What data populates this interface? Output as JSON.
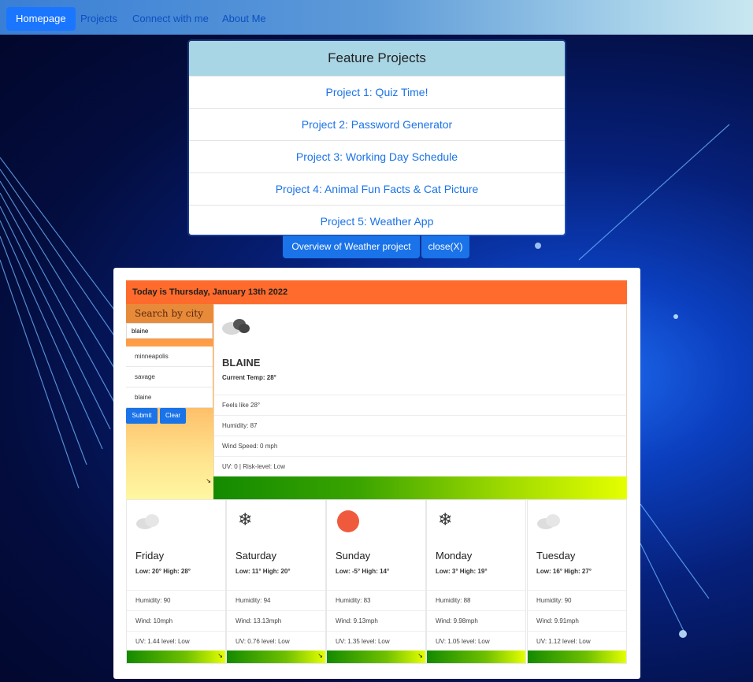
{
  "nav": {
    "items": [
      "Homepage",
      "Projects",
      "Connect with me",
      "About Me"
    ]
  },
  "projects_panel": {
    "title": "Feature Projects",
    "items": [
      "Project 1: Quiz Time!",
      "Project 2: Password Generator",
      "Project 3: Working Day Schedule",
      "Project 4: Animal Fun Facts & Cat Picture",
      "Project 5: Weather App"
    ]
  },
  "overview_button": "Overview of Weather project",
  "close_button": "close(X)",
  "weather": {
    "date": "Today is Thursday, January 13th 2022",
    "search_title": "Search by city",
    "search_value": "blaine",
    "history": [
      "minneapolis",
      "savage",
      "blaine"
    ],
    "submit": "Submit",
    "clear": "Clear",
    "current": {
      "icon": "cloud-icon",
      "city": "BLAINE",
      "temp": "Current Temp: 28°",
      "feels": "Feels like 28°",
      "humidity": "Humidity: 87",
      "wind": "Wind Speed: 0 mph",
      "uv": "UV: 0 | Risk-level: Low"
    },
    "forecast": [
      {
        "day": "Friday",
        "range": "Low: 20° High: 28°",
        "humidity": "Humidity: 90",
        "wind": "Wind: 10mph",
        "uv": "UV: 1.44 level: Low",
        "icon": "cloud-icon"
      },
      {
        "day": "Saturday",
        "range": "Low: 11° High: 20°",
        "humidity": "Humidity: 94",
        "wind": "Wind: 13.13mph",
        "uv": "UV: 0.76 level: Low",
        "icon": "snowflake-icon"
      },
      {
        "day": "Sunday",
        "range": "Low: -5° High: 14°",
        "humidity": "Humidity: 83",
        "wind": "Wind: 9.13mph",
        "uv": "UV: 1.35 level: Low",
        "icon": "sun-icon"
      },
      {
        "day": "Monday",
        "range": "Low: 3° High: 19°",
        "humidity": "Humidity: 88",
        "wind": "Wind: 9.98mph",
        "uv": "UV: 1.05 level: Low",
        "icon": "snowflake-icon"
      },
      {
        "day": "Tuesday",
        "range": "Low: 16° High: 27°",
        "humidity": "Humidity: 90",
        "wind": "Wind: 9.91mph",
        "uv": "UV: 1.12 level: Low",
        "icon": "cloud-icon"
      }
    ]
  },
  "colors": {
    "accent": "#1a73e8",
    "header_orange": "#fe6b2c",
    "panel_head": "#a9d6e5"
  }
}
